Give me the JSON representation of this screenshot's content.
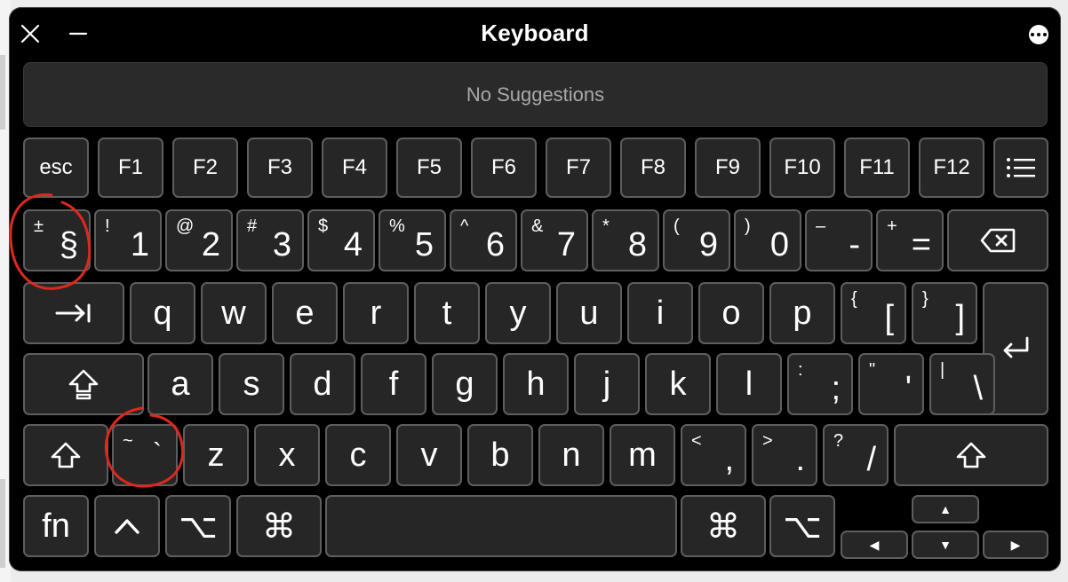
{
  "window": {
    "title": "Keyboard"
  },
  "suggestions": {
    "text": "No Suggestions"
  },
  "function_row": {
    "esc": "esc",
    "f1": "F1",
    "f2": "F2",
    "f3": "F3",
    "f4": "F4",
    "f5": "F5",
    "f6": "F6",
    "f7": "F7",
    "f8": "F8",
    "f9": "F9",
    "f10": "F10",
    "f11": "F11",
    "f12": "F12"
  },
  "number_row": [
    {
      "shift": "±",
      "main": "§"
    },
    {
      "shift": "!",
      "main": "1"
    },
    {
      "shift": "@",
      "main": "2"
    },
    {
      "shift": "#",
      "main": "3"
    },
    {
      "shift": "$",
      "main": "4"
    },
    {
      "shift": "%",
      "main": "5"
    },
    {
      "shift": "^",
      "main": "6"
    },
    {
      "shift": "&",
      "main": "7"
    },
    {
      "shift": "*",
      "main": "8"
    },
    {
      "shift": "(",
      "main": "9"
    },
    {
      "shift": ")",
      "main": "0"
    },
    {
      "shift": "–",
      "main": "-"
    },
    {
      "shift": "+",
      "main": "="
    }
  ],
  "letters": {
    "q": "q",
    "w": "w",
    "e": "e",
    "r": "r",
    "t": "t",
    "y": "y",
    "u": "u",
    "i": "i",
    "o": "o",
    "p": "p",
    "a": "a",
    "s": "s",
    "d": "d",
    "f": "f",
    "g": "g",
    "h": "h",
    "j": "j",
    "k": "k",
    "l": "l",
    "z": "z",
    "x": "x",
    "c": "c",
    "v": "v",
    "b": "b",
    "n": "n",
    "m": "m"
  },
  "punct": {
    "lbracket": {
      "shift": "{",
      "main": "["
    },
    "rbracket": {
      "shift": "}",
      "main": "]"
    },
    "semicolon": {
      "shift": ":",
      "main": ";"
    },
    "quote": {
      "shift": "\"",
      "main": "'"
    },
    "backslash": {
      "shift": "|",
      "main": "\\"
    },
    "grave": {
      "shift": "~",
      "main": "`"
    },
    "comma": {
      "shift": "<",
      "main": ","
    },
    "period": {
      "shift": ">",
      "main": "."
    },
    "slash": {
      "shift": "?",
      "main": "/"
    }
  },
  "modifiers": {
    "fn": "fn",
    "control": "^",
    "option": "⌥",
    "command": "⌘"
  },
  "arrows": {
    "up": "▲",
    "left": "◀",
    "down": "▼",
    "right": "▶"
  },
  "icons": [
    "close-icon",
    "minimize-icon",
    "more-icon",
    "menu-list-icon",
    "tab-icon",
    "return-icon",
    "caps-lock-icon",
    "shift-icon",
    "delete-icon"
  ],
  "colors": {
    "window_bg": "#000000",
    "key_bg": "#262626",
    "key_border": "#5e5e5e",
    "annotation": "#e0281c"
  }
}
